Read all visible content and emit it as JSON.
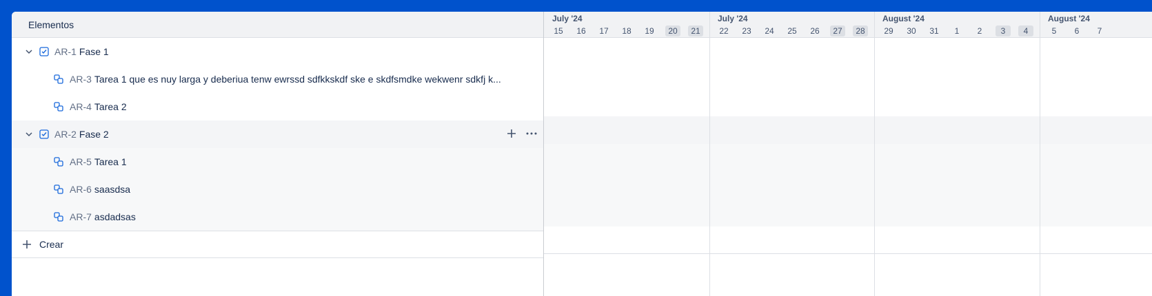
{
  "list": {
    "header": "Elementos",
    "rows": [
      {
        "key": "AR-1",
        "title": "Fase 1",
        "type": "epic"
      },
      {
        "key": "AR-3",
        "title": "Tarea 1 que es nuy larga y deberiua tenw ewrssd sdfkkskdf ske e skdfsmdke wekwenr sdkfj k...",
        "type": "task"
      },
      {
        "key": "AR-4",
        "title": "Tarea 2",
        "type": "task"
      },
      {
        "key": "AR-2",
        "title": "Fase 2",
        "type": "epic"
      },
      {
        "key": "AR-5",
        "title": "Tarea 1",
        "type": "task"
      },
      {
        "key": "AR-6",
        "title": "saasdsa",
        "type": "task"
      },
      {
        "key": "AR-7",
        "title": "asdadsas",
        "type": "task"
      }
    ],
    "create_label": "Crear"
  },
  "timeline": {
    "weeks": [
      {
        "month": "July '24",
        "days": [
          "15",
          "16",
          "17",
          "18",
          "19",
          "20",
          "21"
        ]
      },
      {
        "month": "July '24",
        "days": [
          "22",
          "23",
          "24",
          "25",
          "26",
          "27",
          "28"
        ]
      },
      {
        "month": "August '24",
        "days": [
          "29",
          "30",
          "31",
          "1",
          "2",
          "3",
          "4"
        ]
      },
      {
        "month": "August '24",
        "days": [
          "5",
          "6",
          "7"
        ]
      }
    ]
  },
  "icons": {
    "collapse": "chevron-down-icon",
    "epic": "checkbox-icon",
    "task": "subtask-icon",
    "add": "plus-icon",
    "more": "more-icon"
  },
  "colors": {
    "background_blue": "#0052cc",
    "icon_blue": "#1868db",
    "header_gray": "#f1f2f4",
    "weekend_badge": "#dcdfe4"
  }
}
